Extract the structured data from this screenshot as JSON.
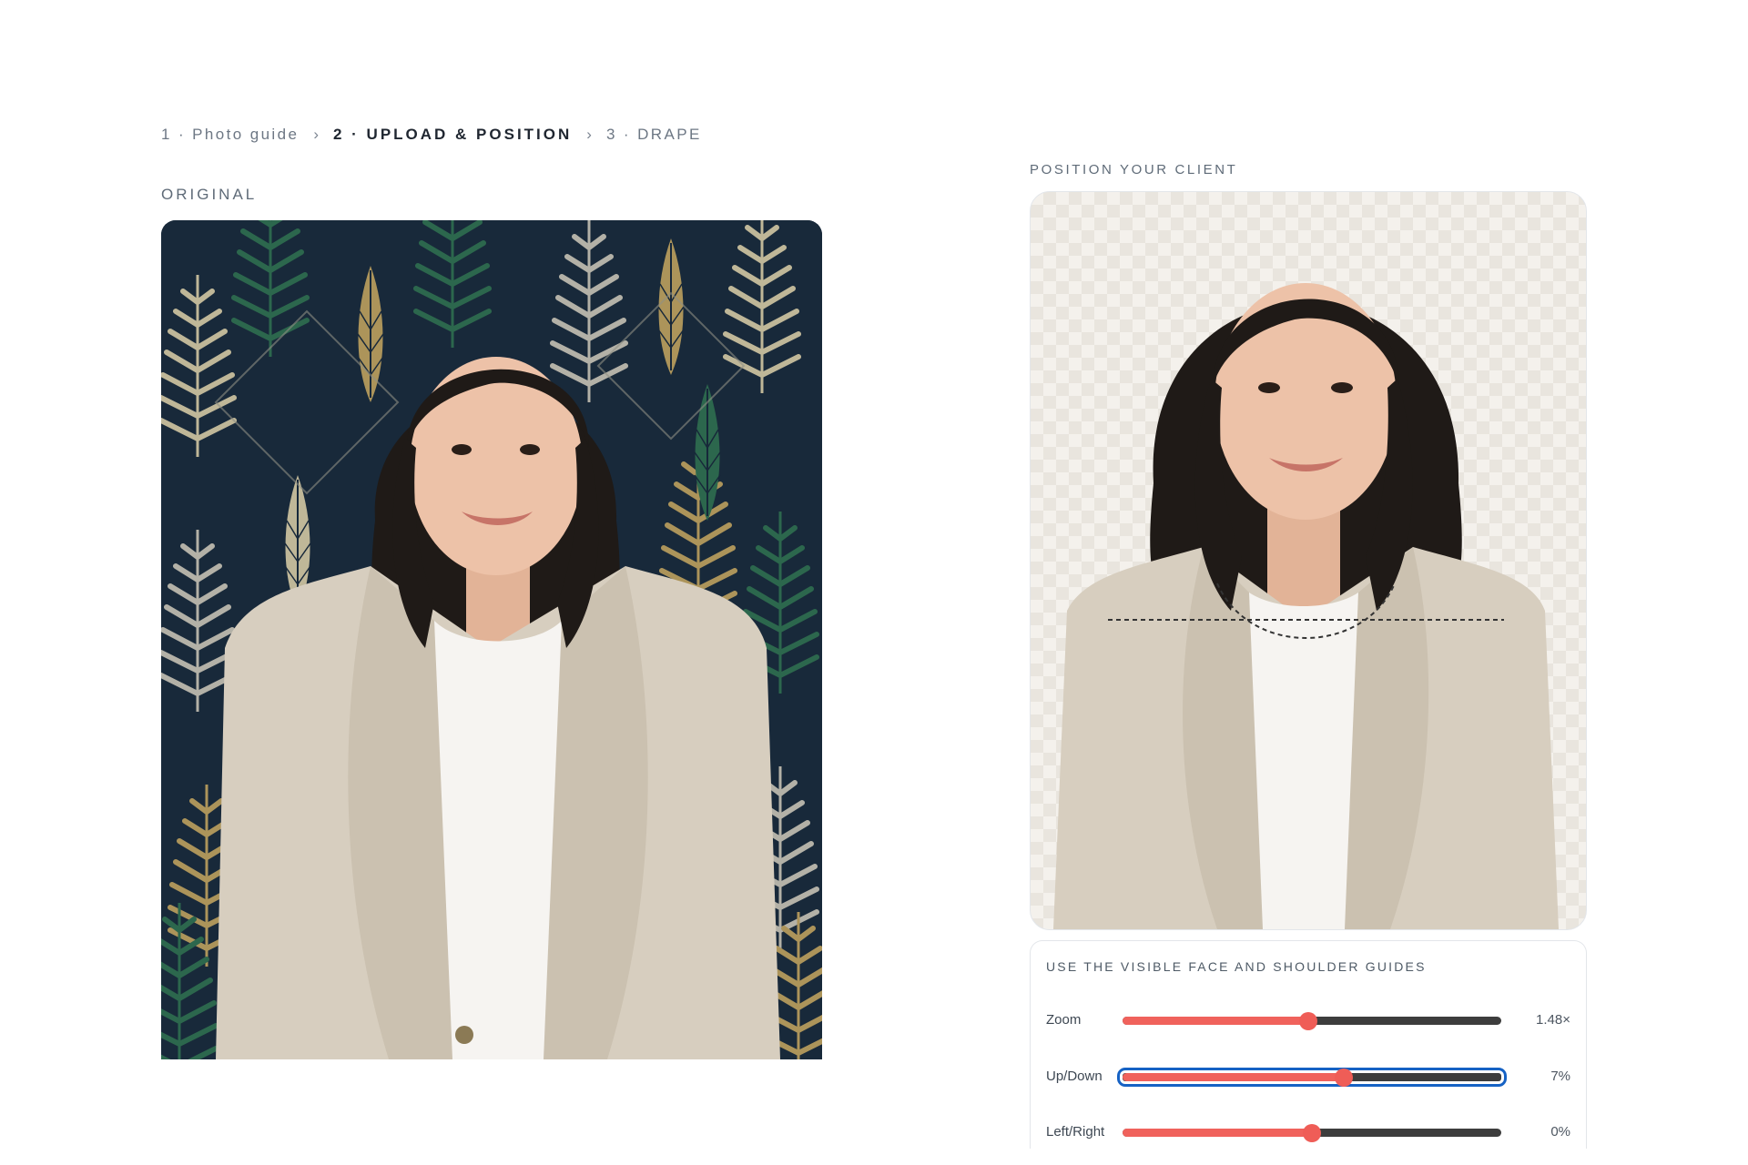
{
  "breadcrumb": {
    "step1": "1 · Photo guide",
    "sep1": "›",
    "step2": "2 · UPLOAD & POSITION",
    "sep2": "›",
    "step3": "3 · DRAPE"
  },
  "original": {
    "label": "ORIGINAL"
  },
  "positioner": {
    "label": "POSITION YOUR CLIENT"
  },
  "controls": {
    "title": "USE THE VISIBLE FACE AND SHOULDER GUIDES",
    "sliders": [
      {
        "label": "Zoom",
        "value": "1.48×",
        "fraction": 0.49
      },
      {
        "label": "Up/Down",
        "value": "7%",
        "fraction": 0.585
      },
      {
        "label": "Left/Right",
        "value": "0%",
        "fraction": 0.5
      }
    ]
  },
  "colors": {
    "accent": "#f0625c",
    "track": "#3d3d3d",
    "focus": "#1662c4",
    "wallpaper": "#18293a",
    "blazer": "#d7cebf",
    "hair": "#1f1a17",
    "skin": "#edc2a8"
  }
}
